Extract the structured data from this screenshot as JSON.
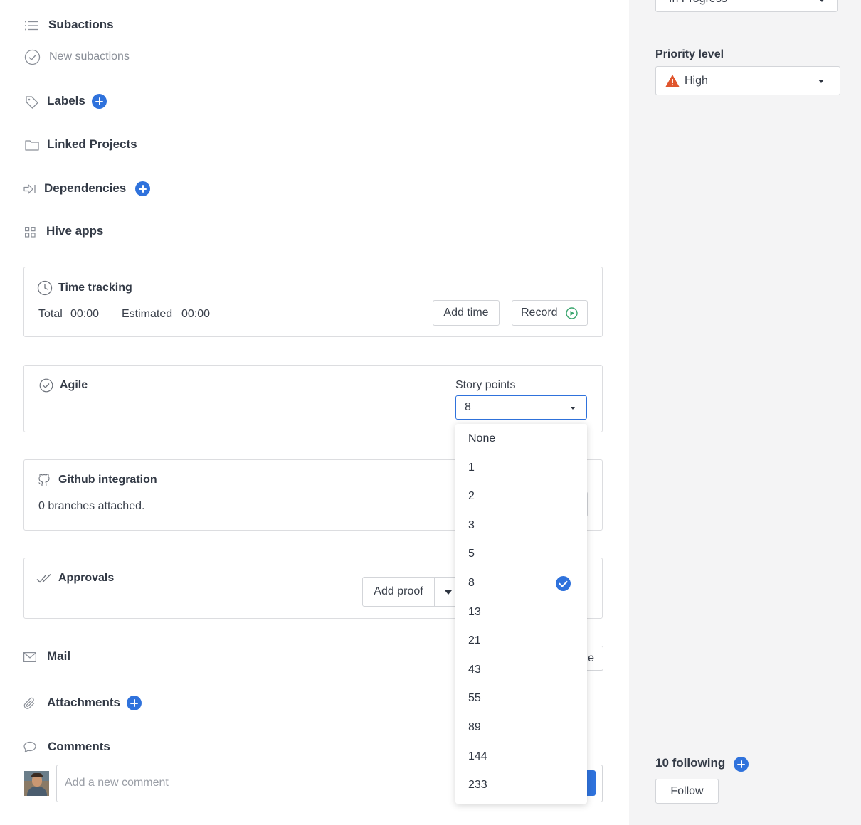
{
  "main": {
    "subactions": {
      "title": "Subactions",
      "new_label": "New subactions"
    },
    "labels": {
      "title": "Labels"
    },
    "linked_projects": {
      "title": "Linked Projects"
    },
    "dependencies": {
      "title": "Dependencies"
    },
    "hive_apps": {
      "title": "Hive apps"
    },
    "time_tracking": {
      "title": "Time tracking",
      "total_label": "Total",
      "total_value": "00:00",
      "estimated_label": "Estimated",
      "estimated_value": "00:00",
      "add_time_label": "Add time",
      "record_label": "Record"
    },
    "agile": {
      "title": "Agile",
      "story_points_label": "Story points",
      "story_points_value": "8"
    },
    "github": {
      "title": "Github integration",
      "branches_text": "0 branches attached."
    },
    "approvals": {
      "title": "Approvals",
      "add_proof_label": "Add proof"
    },
    "mail": {
      "title": "Mail",
      "button_partial": "e"
    },
    "attachments": {
      "title": "Attachments"
    },
    "comments": {
      "title": "Comments",
      "placeholder": "Add a new comment"
    }
  },
  "story_points_dropdown": {
    "options": [
      "None",
      "1",
      "2",
      "3",
      "5",
      "8",
      "13",
      "21",
      "43",
      "55",
      "89",
      "144",
      "233"
    ],
    "selected": "8"
  },
  "sidebar": {
    "status": {
      "value_partial": "In Progress"
    },
    "priority": {
      "label": "Priority level",
      "value": "High"
    },
    "following": {
      "count_label": "10 following",
      "follow_button": "Follow"
    }
  },
  "colors": {
    "accent": "#2f72dc",
    "priority_high": "#e0552d",
    "record_green": "#3aa66e",
    "sidebar_bg": "#f4f4f5"
  }
}
